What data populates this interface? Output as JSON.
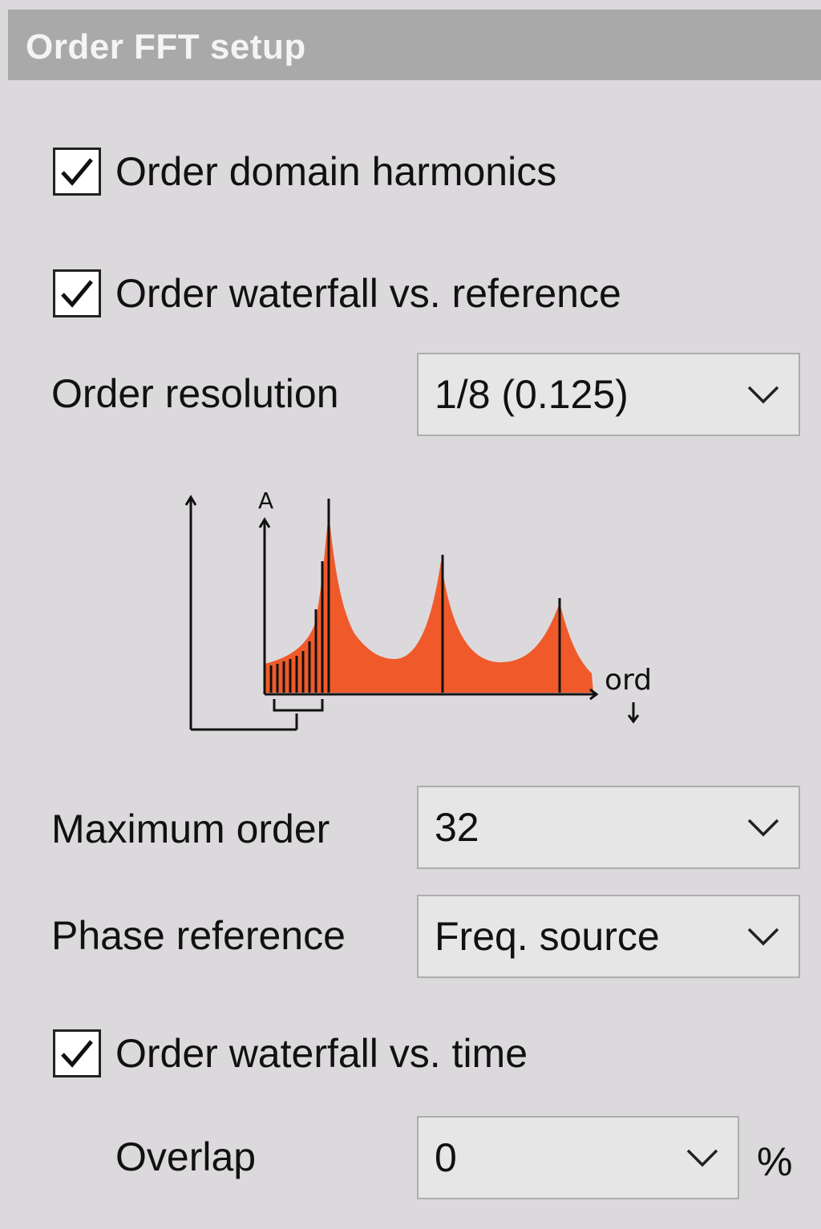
{
  "header": {
    "title": "Order FFT setup"
  },
  "options": {
    "harmonics": {
      "label": "Order domain harmonics",
      "checked": true
    },
    "waterfall_ref": {
      "label": "Order waterfall vs. reference",
      "checked": true
    },
    "waterfall_time": {
      "label": "Order waterfall vs. time",
      "checked": true
    }
  },
  "order_resolution": {
    "label": "Order resolution",
    "value": "1/8 (0.125)"
  },
  "diagram": {
    "y_label": "A",
    "x_label": "ord"
  },
  "maximum_order": {
    "label": "Maximum order",
    "value": "32"
  },
  "phase_reference": {
    "label": "Phase reference",
    "value": "Freq. source"
  },
  "overlap": {
    "label": "Overlap",
    "value": "0",
    "unit": "%"
  },
  "colors": {
    "spectrum_fill": "#f05a2a",
    "header_bg": "#a9a9a9",
    "panel_bg": "#dcd9dc"
  }
}
